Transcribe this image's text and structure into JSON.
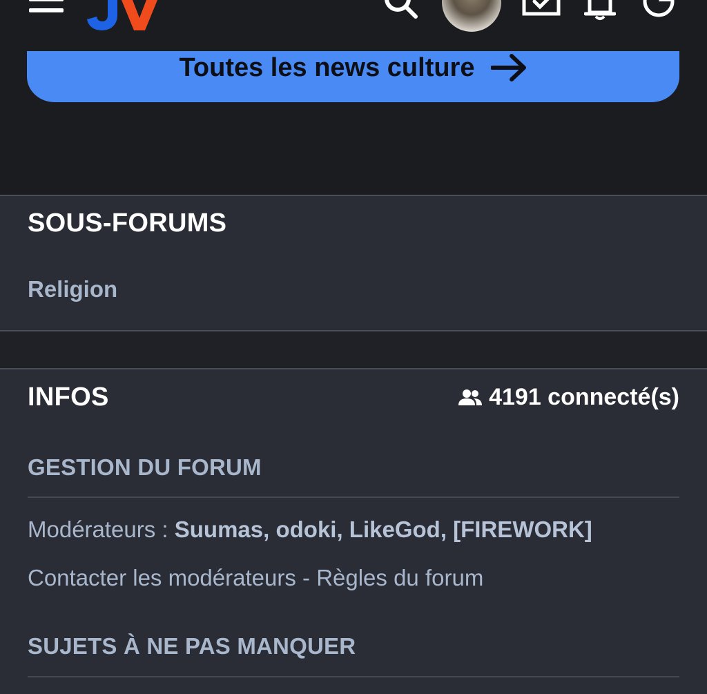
{
  "header": {
    "logo_text": "JV",
    "colors": {
      "background": "#1b1c20",
      "logo_blue": "#1e63e6",
      "logo_red": "#f04b1d"
    },
    "icons": [
      "menu-icon",
      "search-icon",
      "avatar",
      "messages-icon",
      "notifications-icon",
      "theme-icon"
    ]
  },
  "hero": {
    "button_label": "Toutes les news culture",
    "button_icon": "arrow-right-icon",
    "button_color": "#4a8af4"
  },
  "subforums": {
    "title": "SOUS-FORUMS",
    "items": [
      "Religion"
    ]
  },
  "infos": {
    "title": "INFOS",
    "online_count": "4191 connecté(s)",
    "online_icon": "users-icon",
    "management": {
      "heading": "GESTION DU FORUM",
      "moderators_label": "Modérateurs : ",
      "moderators": "Suumas, odoki, LikeGod, [FIREWORK]",
      "contact_link": "Contacter les modérateurs",
      "dash": " - ",
      "rules_link": "Règles du forum"
    },
    "must_read": {
      "heading": "SUJETS À NE PAS MANQUER"
    }
  },
  "theme": {
    "page_background": "#2a2d35",
    "muted_text": "#a9b7cc",
    "separator": "#4a4e58"
  }
}
